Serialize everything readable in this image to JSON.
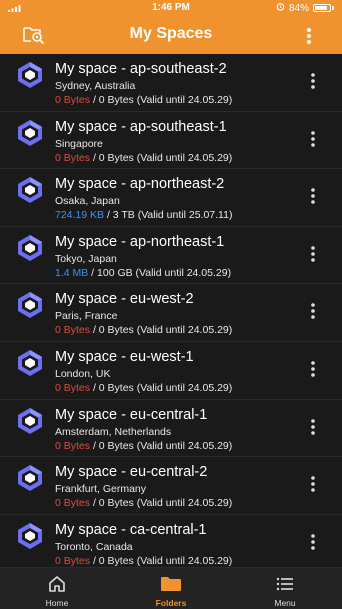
{
  "status_bar": {
    "time": "1:46 PM",
    "battery_text": "84%",
    "battery_level": 0.84
  },
  "header": {
    "title": "My Spaces",
    "left_icon": "spaces-search-icon",
    "right_icon": "more-vertical-icon"
  },
  "colors": {
    "accent": "#f0922d",
    "zero_usage": "#e04a3e",
    "used": "#3f8ff0"
  },
  "spaces": [
    {
      "name": "My space - ap-southeast-2",
      "location": "Sydney, Australia",
      "used": "0 Bytes",
      "used_color": "red",
      "rest": " / 0 Bytes (Valid until 24.05.29)"
    },
    {
      "name": "My space - ap-southeast-1",
      "location": "Singapore",
      "used": "0 Bytes",
      "used_color": "red",
      "rest": " / 0 Bytes (Valid until 24.05.29)"
    },
    {
      "name": "My space - ap-northeast-2",
      "location": "Osaka, Japan",
      "used": "724.19 KB",
      "used_color": "blue",
      "rest": " / 3 TB (Valid until 25.07.11)"
    },
    {
      "name": "My space - ap-northeast-1",
      "location": "Tokyo, Japan",
      "used": "1.4 MB",
      "used_color": "blue",
      "rest": " / 100 GB (Valid until 24.05.29)"
    },
    {
      "name": "My space - eu-west-2",
      "location": "Paris, France",
      "used": "0 Bytes",
      "used_color": "red",
      "rest": " / 0 Bytes (Valid until 24.05.29)"
    },
    {
      "name": "My space - eu-west-1",
      "location": "London, UK",
      "used": "0 Bytes",
      "used_color": "red",
      "rest": " / 0 Bytes (Valid until 24.05.29)"
    },
    {
      "name": "My space - eu-central-1",
      "location": "Amsterdam, Netherlands",
      "used": "0 Bytes",
      "used_color": "red",
      "rest": " / 0 Bytes (Valid until 24.05.29)"
    },
    {
      "name": "My space - eu-central-2",
      "location": "Frankfurt, Germany",
      "used": "0 Bytes",
      "used_color": "red",
      "rest": " / 0 Bytes (Valid until 24.05.29)"
    },
    {
      "name": "My space - ca-central-1",
      "location": "Toronto, Canada",
      "used": "0 Bytes",
      "used_color": "red",
      "rest": " / 0 Bytes (Valid until 24.05.29)"
    }
  ],
  "tabs": [
    {
      "label": "Home",
      "icon": "home-icon",
      "active": false
    },
    {
      "label": "Folders",
      "icon": "folder-icon",
      "active": true
    },
    {
      "label": "Menu",
      "icon": "list-menu-icon",
      "active": false
    }
  ]
}
